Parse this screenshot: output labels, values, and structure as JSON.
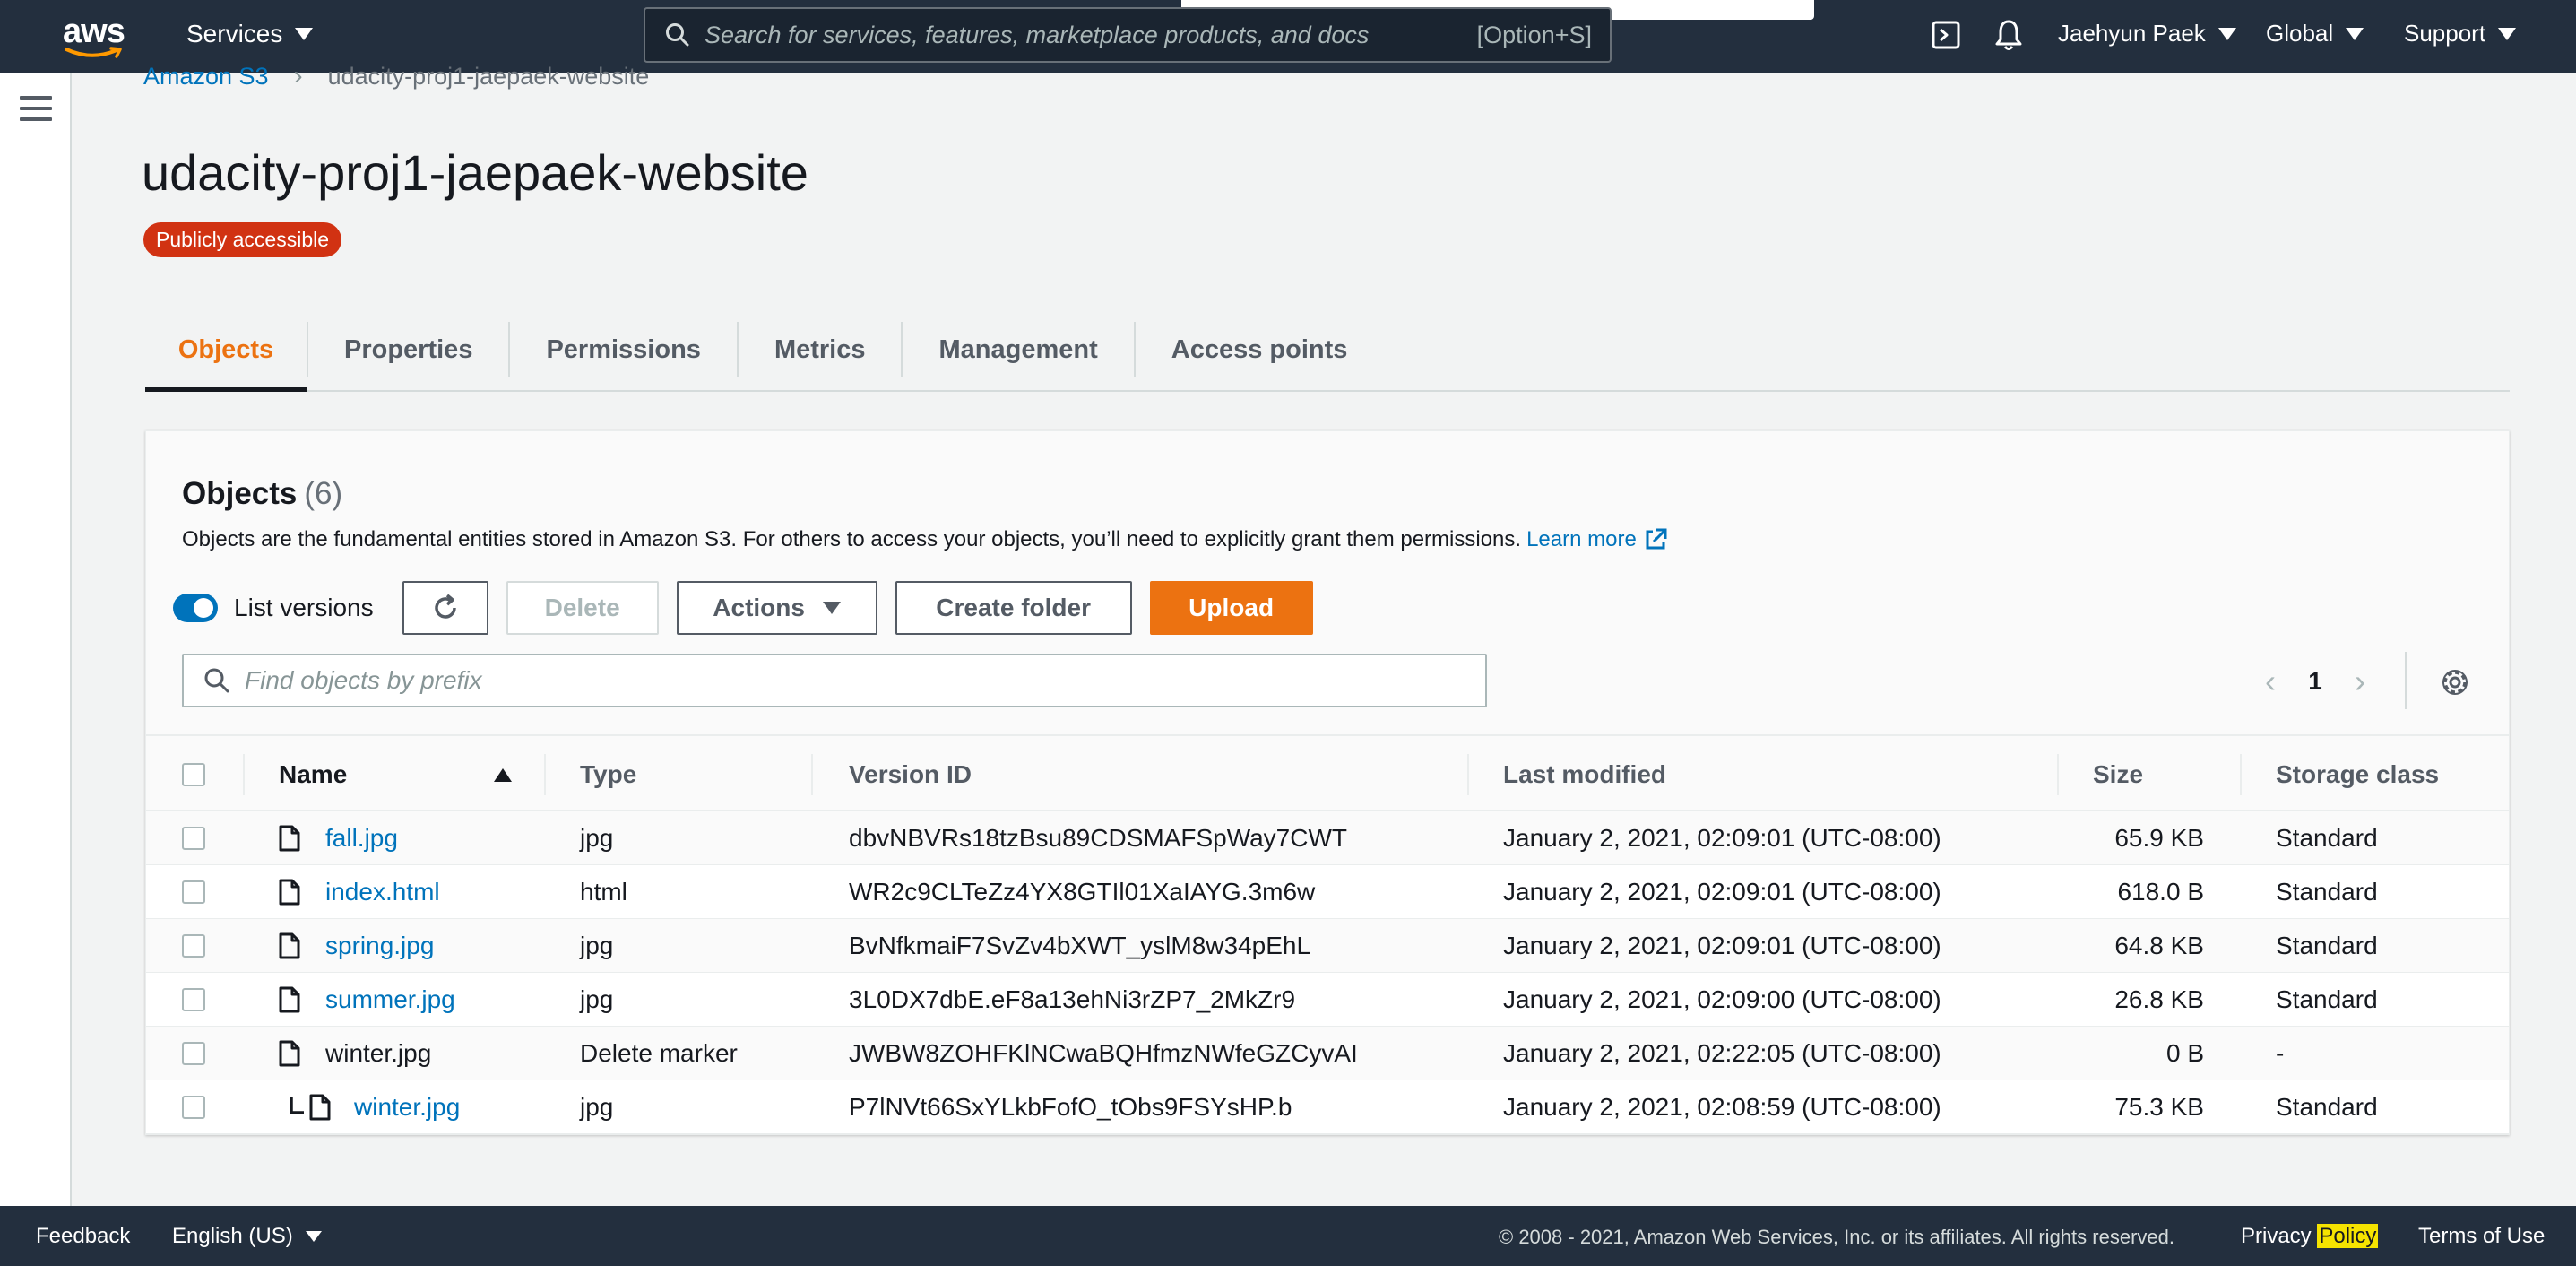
{
  "nav": {
    "logo_text": "aws",
    "services_label": "Services",
    "search_placeholder": "Search for services, features, marketplace products, and docs",
    "search_shortcut": "[Option+S]",
    "user_label": "Jaehyun Paek",
    "region_label": "Global",
    "support_label": "Support"
  },
  "breadcrumb": {
    "root": "Amazon S3",
    "current": "udacity-proj1-jaepaek-website"
  },
  "bucket": {
    "title": "udacity-proj1-jaepaek-website",
    "badge": "Publicly accessible"
  },
  "tabs": [
    {
      "label": "Objects",
      "active": true
    },
    {
      "label": "Properties"
    },
    {
      "label": "Permissions"
    },
    {
      "label": "Metrics"
    },
    {
      "label": "Management"
    },
    {
      "label": "Access points"
    }
  ],
  "objects_panel": {
    "title": "Objects",
    "count": "(6)",
    "description": "Objects are the fundamental entities stored in Amazon S3. For others to access your objects, you’ll need to explicitly grant them permissions.",
    "learn_more": "Learn more",
    "list_versions_label": "List versions",
    "list_versions_on": true,
    "delete_label": "Delete",
    "actions_label": "Actions",
    "create_folder_label": "Create folder",
    "upload_label": "Upload",
    "find_placeholder": "Find objects by prefix",
    "page_number": "1"
  },
  "table": {
    "headers": [
      "Name",
      "Type",
      "Version ID",
      "Last modified",
      "Size",
      "Storage class"
    ],
    "rows": [
      {
        "name": "fall.jpg",
        "type": "jpg",
        "version": "dbvNBVRs18tzBsu89CDSMAFSpWay7CWT",
        "modified": "January 2, 2021, 02:09:01 (UTC-08:00)",
        "size": "65.9 KB",
        "storage": "Standard"
      },
      {
        "name": "index.html",
        "type": "html",
        "version": "WR2c9CLTeZz4YX8GTIl01XaIAYG.3m6w",
        "modified": "January 2, 2021, 02:09:01 (UTC-08:00)",
        "size": "618.0 B",
        "storage": "Standard"
      },
      {
        "name": "spring.jpg",
        "type": "jpg",
        "version": "BvNfkmaiF7SvZv4bXWT_yslM8w34pEhL",
        "modified": "January 2, 2021, 02:09:01 (UTC-08:00)",
        "size": "64.8 KB",
        "storage": "Standard"
      },
      {
        "name": "summer.jpg",
        "type": "jpg",
        "version": "3L0DX7dbE.eF8a13ehNi3rZP7_2MkZr9",
        "modified": "January 2, 2021, 02:09:00 (UTC-08:00)",
        "size": "26.8 KB",
        "storage": "Standard"
      },
      {
        "name": "winter.jpg",
        "type": "Delete marker",
        "version": "JWBW8ZOHFKlNCwaBQHfmzNWfeGZCyvAI",
        "modified": "January 2, 2021, 02:22:05 (UTC-08:00)",
        "size": "0 B",
        "storage": "-"
      },
      {
        "name": "winter.jpg",
        "type": "jpg",
        "version": "P7lNVt66SxYLkbFofO_tObs9FSYsHP.b",
        "modified": "January 2, 2021, 02:08:59 (UTC-08:00)",
        "size": "75.3 KB",
        "storage": "Standard"
      }
    ]
  },
  "footer": {
    "feedback": "Feedback",
    "language": "English (US)",
    "copyright": "© 2008 - 2021, Amazon Web Services, Inc. or its affiliates. All rights reserved.",
    "privacy_prefix": "Privacy",
    "privacy_highlight": "Policy",
    "terms": "Terms of Use"
  },
  "colors": {
    "nav_bg": "#232f3e",
    "accent_orange": "#ec7211",
    "link_blue": "#0073bb",
    "badge_red": "#d13212"
  }
}
